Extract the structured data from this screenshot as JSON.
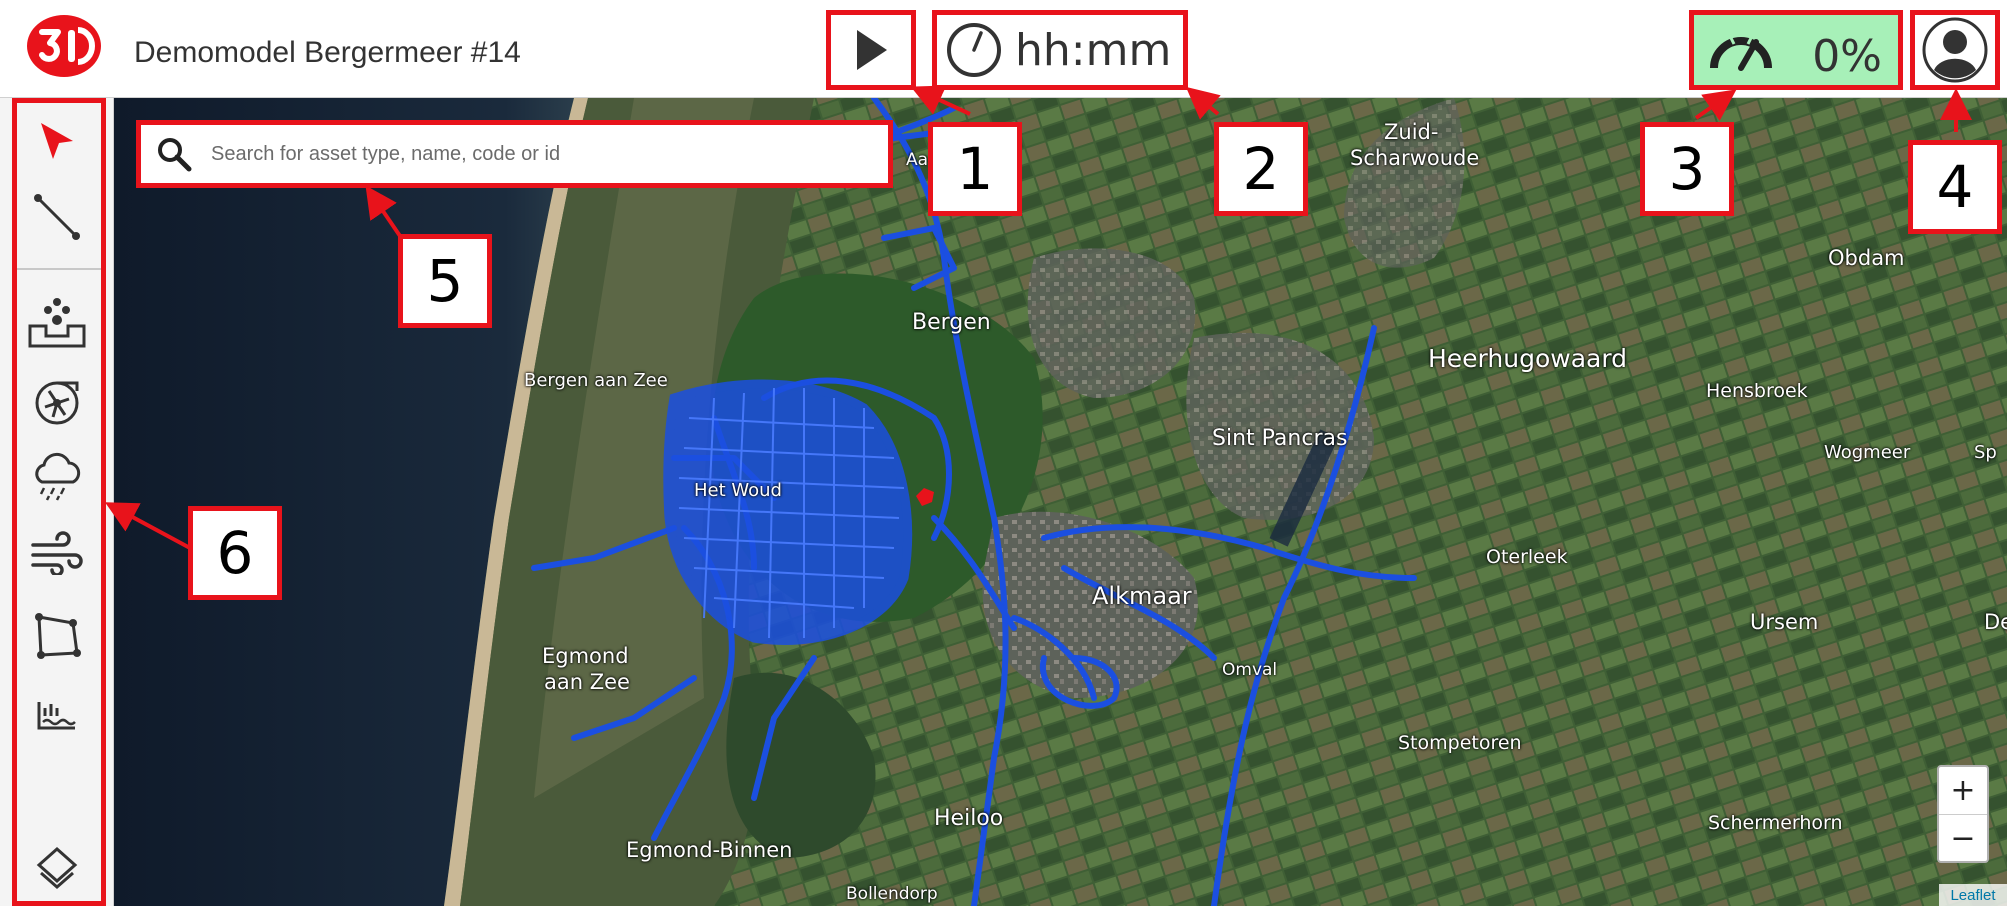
{
  "app": {
    "title": "Demomodel Bergermeer #14",
    "logo_icon": "3di-logo",
    "brand_color": "#e8131b"
  },
  "toolbar": {
    "play_icon": "play-icon",
    "time_placeholder": "hh:mm",
    "speed_value": "0%",
    "speed_bg_color": "#a7f0b8",
    "user_icon": "user-avatar-icon"
  },
  "search": {
    "placeholder": "Search for asset type, name, code or id"
  },
  "sidebar": {
    "tools": [
      {
        "name": "select",
        "icon": "cursor-arrow-icon"
      },
      {
        "name": "line",
        "icon": "line-icon"
      },
      {
        "name": "breach",
        "icon": "fountain-icon"
      },
      {
        "name": "pump",
        "icon": "pump-icon"
      },
      {
        "name": "rain",
        "icon": "rain-cloud-icon"
      },
      {
        "name": "wind",
        "icon": "wind-icon"
      },
      {
        "name": "polygon",
        "icon": "polygon-icon"
      },
      {
        "name": "water-level",
        "icon": "water-level-icon"
      },
      {
        "name": "layers",
        "icon": "layers-icon"
      }
    ]
  },
  "map": {
    "places": [
      "Zuid-",
      "Scharwoude",
      "Obdam",
      "Bergen",
      "Heerhugowaard",
      "Bergen aan Zee",
      "Hensbroek",
      "Sint Pancras",
      "Wogmeer",
      "Sp",
      "Het Woud",
      "Oterleek",
      "Alkmaar",
      "Ursem",
      "De",
      "Egmond",
      "aan Zee",
      "Omval",
      "Stompetoren",
      "Heiloo",
      "Schermerhorn",
      "Egmond-Binnen",
      "Bollendorp",
      "Aag"
    ],
    "zoom_in": "+",
    "zoom_out": "−",
    "attribution": "Leaflet",
    "network_color": "#1b4fe0"
  },
  "callouts": [
    "1",
    "2",
    "3",
    "4",
    "5",
    "6"
  ]
}
